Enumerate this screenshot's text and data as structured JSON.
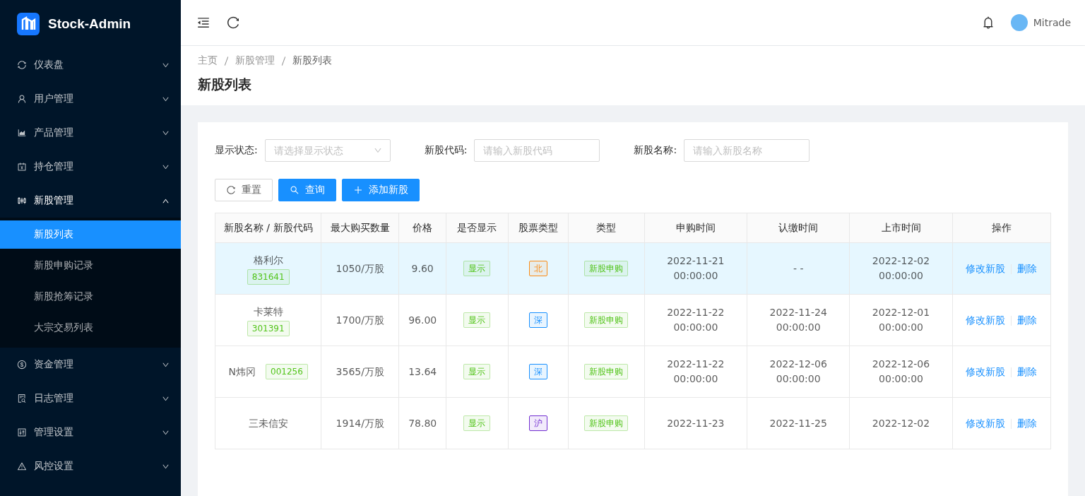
{
  "app": {
    "title": "Stock-Admin"
  },
  "sidebar": {
    "items": [
      {
        "label": "仪表盘",
        "expanded": false
      },
      {
        "label": "用户管理",
        "expanded": false
      },
      {
        "label": "产品管理",
        "expanded": false
      },
      {
        "label": "持仓管理",
        "expanded": false
      },
      {
        "label": "新股管理",
        "expanded": true,
        "children": [
          {
            "label": "新股列表",
            "selected": true
          },
          {
            "label": "新股申购记录",
            "selected": false
          },
          {
            "label": "新股抢筹记录",
            "selected": false
          },
          {
            "label": "大宗交易列表",
            "selected": false
          }
        ]
      },
      {
        "label": "资金管理",
        "expanded": false
      },
      {
        "label": "日志管理",
        "expanded": false
      },
      {
        "label": "管理设置",
        "expanded": false
      },
      {
        "label": "风控设置",
        "expanded": false
      }
    ]
  },
  "header": {
    "user": "Mitrade"
  },
  "breadcrumb": [
    "主页",
    "新股管理",
    "新股列表"
  ],
  "page_title": "新股列表",
  "filters": [
    {
      "kind": "select",
      "label": "显示状态:",
      "placeholder": "请选择显示状态"
    },
    {
      "kind": "input",
      "label": "新股代码:",
      "placeholder": "请输入新股代码"
    },
    {
      "kind": "input",
      "label": "新股名称:",
      "placeholder": "请输入新股名称"
    }
  ],
  "buttons": [
    {
      "kind": "reset",
      "label": "重置"
    },
    {
      "kind": "search",
      "label": "查询"
    },
    {
      "kind": "add",
      "label": "添加新股"
    }
  ],
  "table": {
    "columns": [
      "新股名称 / 新股代码",
      "最大购买数量",
      "价格",
      "是否显示",
      "股票类型",
      "类型",
      "申购时间",
      "认缴时间",
      "上市时间",
      "操作"
    ],
    "rows": [
      {
        "selected": true,
        "name": "格利尔",
        "code": "831641",
        "code_inline": false,
        "quantity": "1050/万股",
        "price": "9.60",
        "display": "显示",
        "market": {
          "label": "北",
          "color": "#fa8c16"
        },
        "type": "新股申购",
        "subscribe": [
          "2022-11-21",
          "00:00:00"
        ],
        "payment": [
          "- -"
        ],
        "listing": [
          "2022-12-02",
          "00:00:00"
        ],
        "actions": [
          "修改新股",
          "删除"
        ]
      },
      {
        "selected": false,
        "name": "卡莱特",
        "code": "301391",
        "code_inline": false,
        "quantity": "1700/万股",
        "price": "96.00",
        "display": "显示",
        "market": {
          "label": "深",
          "color": "#1890ff"
        },
        "type": "新股申购",
        "subscribe": [
          "2022-11-22",
          "00:00:00"
        ],
        "payment": [
          "2022-11-24",
          "00:00:00"
        ],
        "listing": [
          "2022-12-01",
          "00:00:00"
        ],
        "actions": [
          "修改新股",
          "删除"
        ]
      },
      {
        "selected": false,
        "name": "N炜冈",
        "code": "001256",
        "code_inline": true,
        "quantity": "3565/万股",
        "price": "13.64",
        "display": "显示",
        "market": {
          "label": "深",
          "color": "#1890ff"
        },
        "type": "新股申购",
        "subscribe": [
          "2022-11-22",
          "00:00:00"
        ],
        "payment": [
          "2022-12-06",
          "00:00:00"
        ],
        "listing": [
          "2022-12-06",
          "00:00:00"
        ],
        "actions": [
          "修改新股",
          "删除"
        ]
      },
      {
        "selected": false,
        "name": "三未信安",
        "quantity": "1914/万股",
        "price": "78.80",
        "display": "显示",
        "market": {
          "label": "沪",
          "color": "#722ed1"
        },
        "type": "新股申购",
        "subscribe": [
          "2022-11-23"
        ],
        "payment": [
          "2022-11-25"
        ],
        "listing": [
          "2022-12-02"
        ],
        "actions": [
          "修改新股",
          "删除"
        ]
      }
    ]
  }
}
